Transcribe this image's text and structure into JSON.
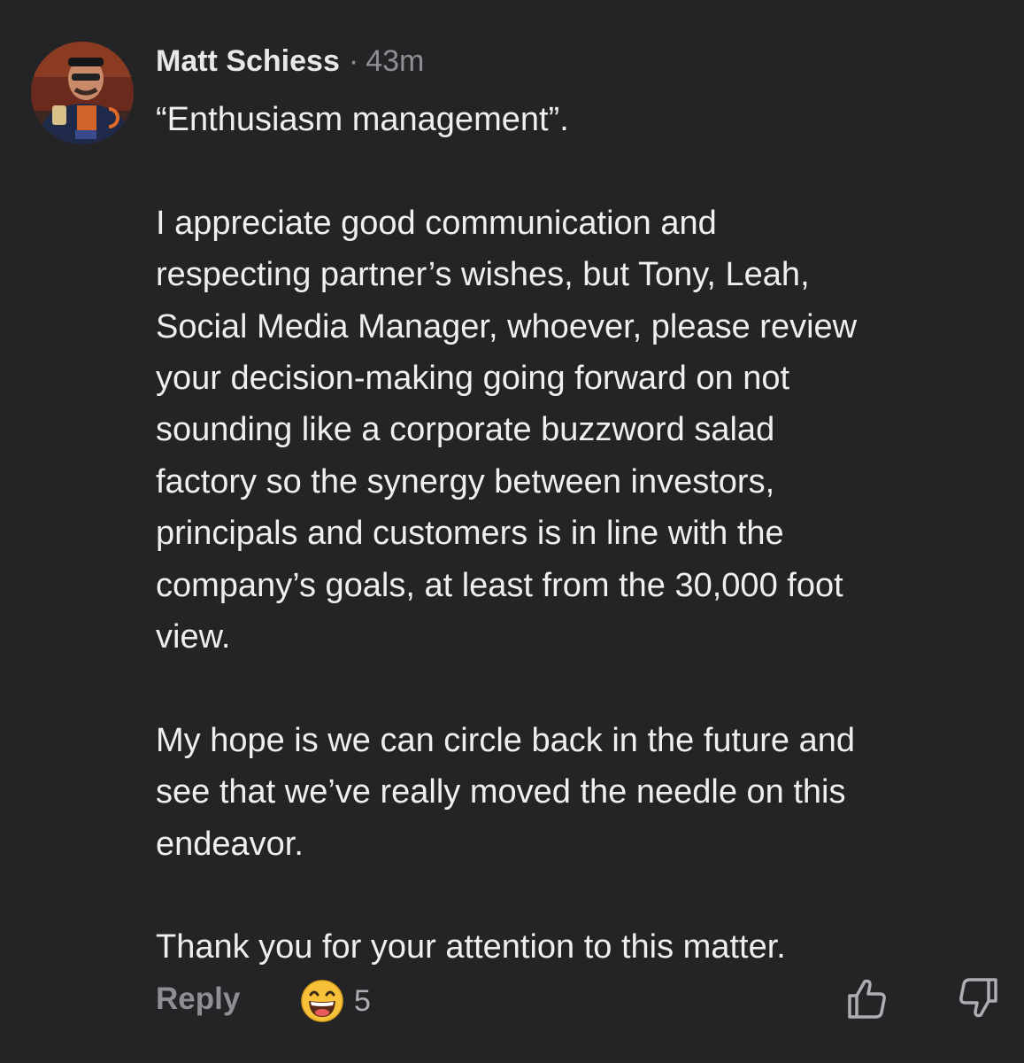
{
  "comment": {
    "author": "Matt Schiess",
    "separator": "·",
    "time": "43m",
    "paragraphs": [
      "“Enthusiasm management”.",
      "I appreciate good communication and\nrespecting partner’s wishes, but Tony, Leah,\nSocial Media Manager, whoever, please review\nyour decision-making going forward on not\nsounding like a corporate buzzword salad\nfactory so the synergy between investors,\nprincipals and customers is in line with the\ncompany’s goals, at least from the 30,000 foot\nview.",
      "My hope is we can circle back in the future and\nsee that we’ve really moved the needle on this\nendeavor.",
      "Thank you for your attention to this matter."
    ]
  },
  "actions": {
    "reply_label": "Reply",
    "reaction_icon": "grinning-face-emoji-icon",
    "reaction_count": "5",
    "like_icon": "thumbs-up-icon",
    "dislike_icon": "thumbs-down-icon"
  },
  "colors": {
    "background": "#242426",
    "text": "#efefef",
    "muted": "#8e8e93"
  }
}
